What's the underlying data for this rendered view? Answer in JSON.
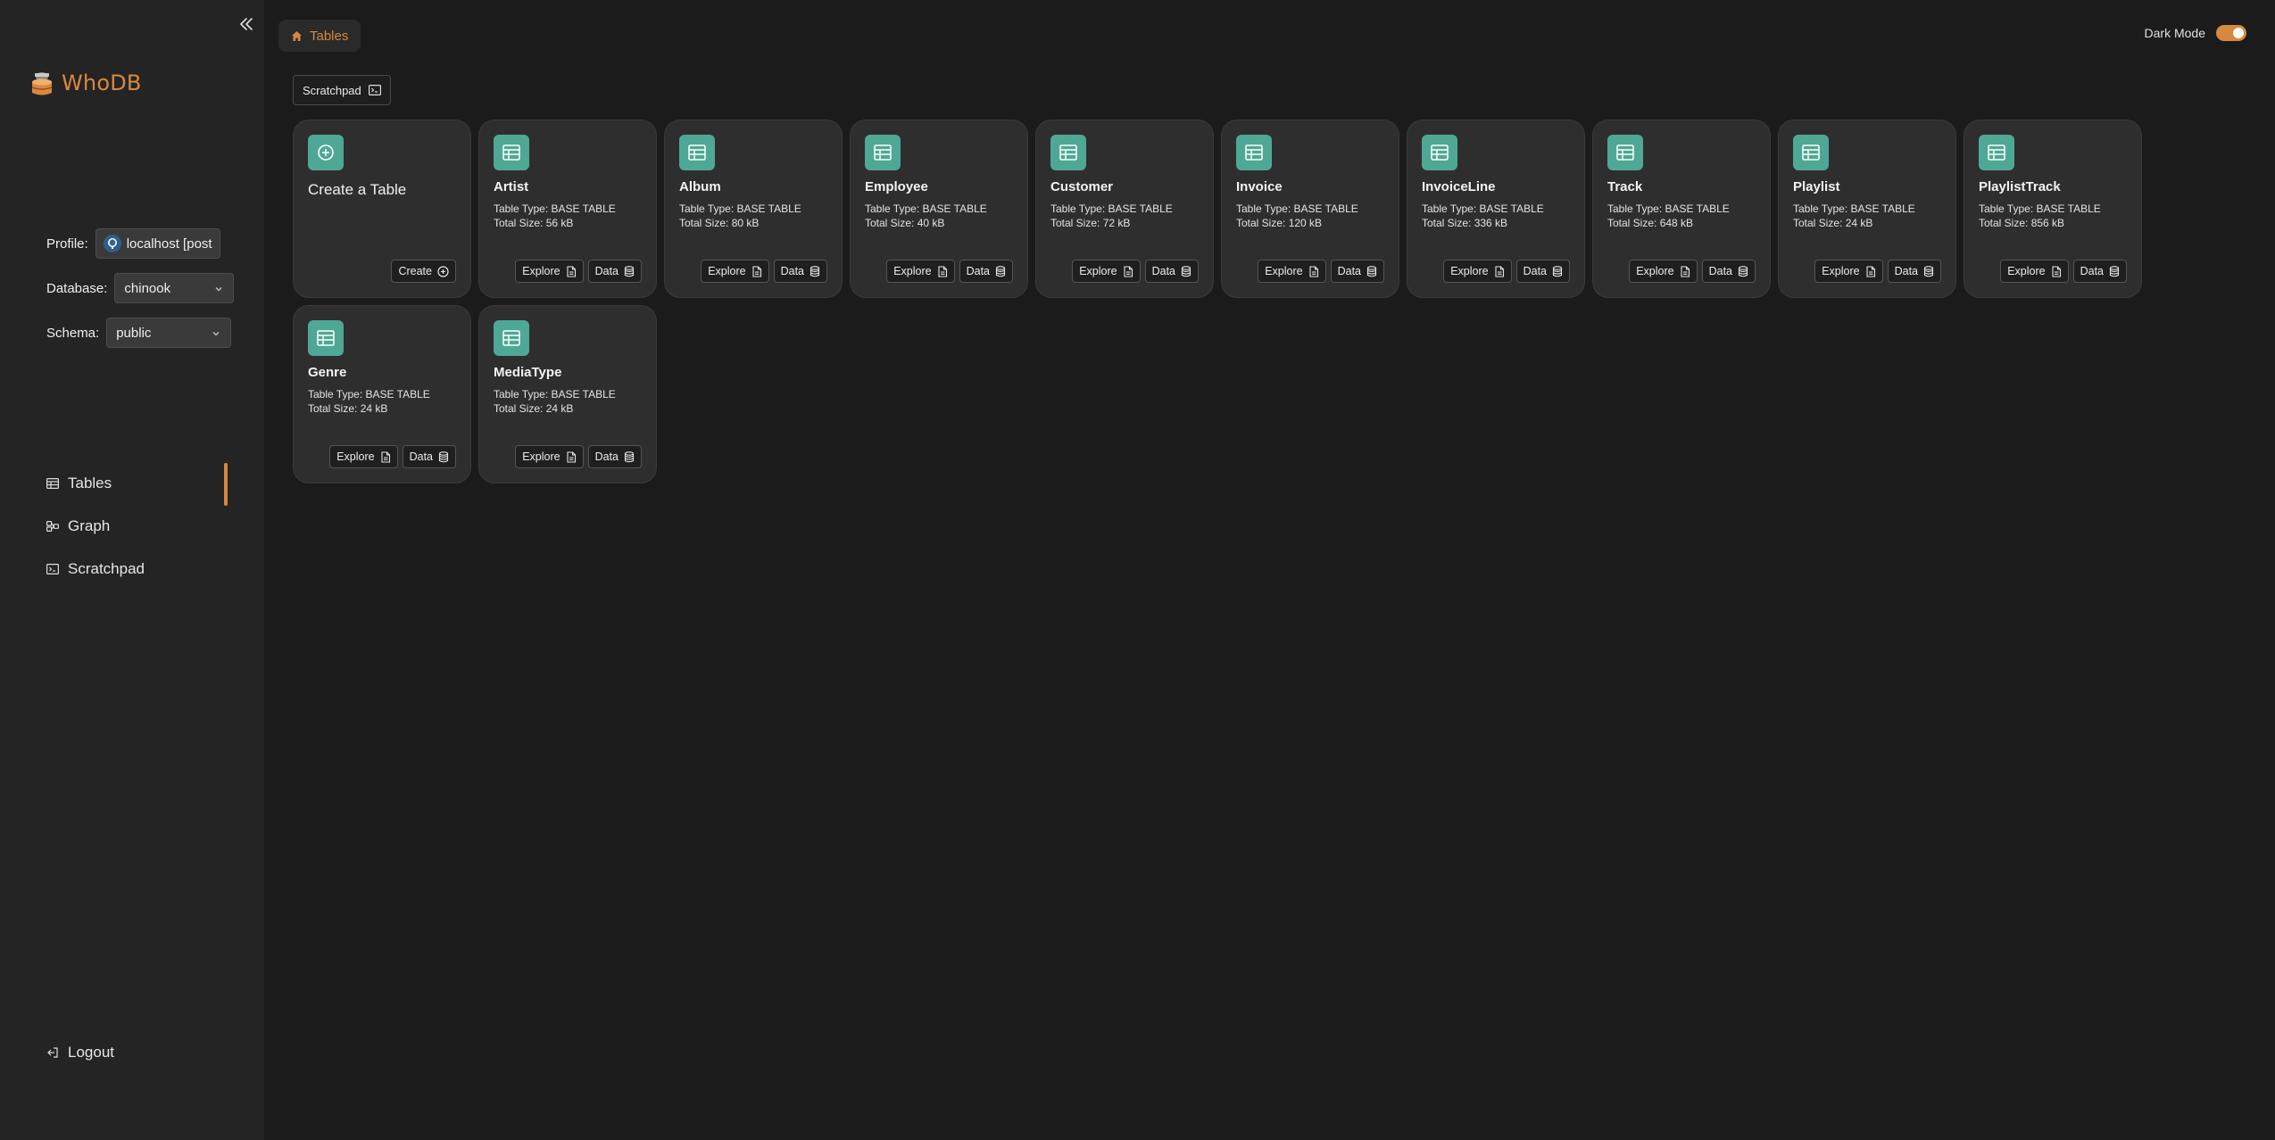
{
  "app": {
    "name": "WhoDB",
    "colors": {
      "accent": "#d8883f",
      "icon_tile": "#4ea895",
      "background": "#1b1b1b",
      "sidebar": "#242424",
      "card": "#2e2e2e"
    }
  },
  "sidebar": {
    "profile_label": "Profile:",
    "profile_value": "localhost [post",
    "database_label": "Database:",
    "database_value": "chinook",
    "schema_label": "Schema:",
    "schema_value": "public",
    "nav": [
      {
        "label": "Tables",
        "icon": "table-icon",
        "active": true
      },
      {
        "label": "Graph",
        "icon": "graph-icon",
        "active": false
      },
      {
        "label": "Scratchpad",
        "icon": "terminal-icon",
        "active": false
      }
    ],
    "logout_label": "Logout"
  },
  "header": {
    "breadcrumb": "Tables",
    "dark_mode_label": "Dark Mode",
    "dark_mode_on": true
  },
  "toolbar": {
    "scratchpad_label": "Scratchpad"
  },
  "create_card": {
    "title": "Create a Table",
    "button_label": "Create"
  },
  "table_type_prefix": "Table Type: ",
  "total_size_prefix": "Total Size: ",
  "explore_label": "Explore",
  "data_label": "Data",
  "tables": [
    {
      "name": "Artist",
      "type": "BASE TABLE",
      "size": "56 kB"
    },
    {
      "name": "Album",
      "type": "BASE TABLE",
      "size": "80 kB"
    },
    {
      "name": "Employee",
      "type": "BASE TABLE",
      "size": "40 kB"
    },
    {
      "name": "Customer",
      "type": "BASE TABLE",
      "size": "72 kB"
    },
    {
      "name": "Invoice",
      "type": "BASE TABLE",
      "size": "120 kB"
    },
    {
      "name": "InvoiceLine",
      "type": "BASE TABLE",
      "size": "336 kB"
    },
    {
      "name": "Track",
      "type": "BASE TABLE",
      "size": "648 kB"
    },
    {
      "name": "Playlist",
      "type": "BASE TABLE",
      "size": "24 kB"
    },
    {
      "name": "PlaylistTrack",
      "type": "BASE TABLE",
      "size": "856 kB"
    },
    {
      "name": "Genre",
      "type": "BASE TABLE",
      "size": "24 kB"
    },
    {
      "name": "MediaType",
      "type": "BASE TABLE",
      "size": "24 kB"
    }
  ]
}
